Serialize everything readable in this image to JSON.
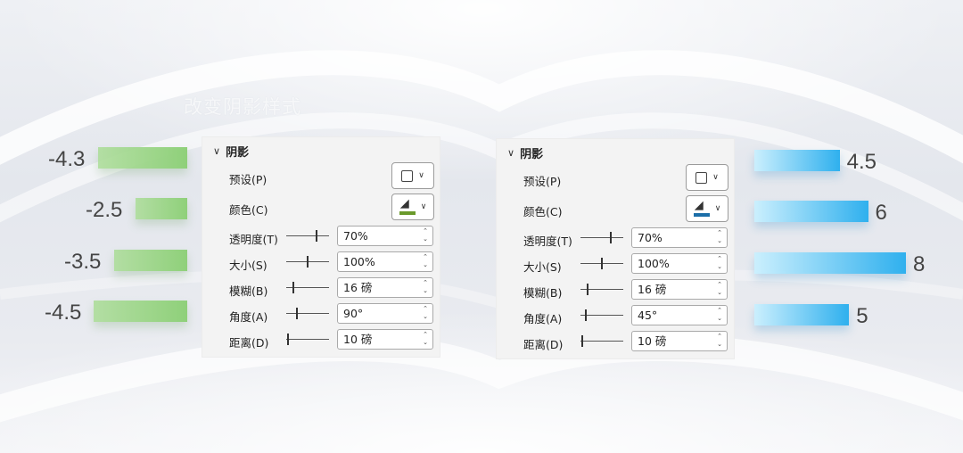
{
  "ghost_title": "改变阴影样式",
  "colors": {
    "negative_bar": "#8fd07a",
    "positive_bar": "#2fb0ee",
    "bucket_green": "#6a9a2b",
    "bucket_blue": "#1b6ea8"
  },
  "chart_data": [
    {
      "type": "bar",
      "orientation": "horizontal",
      "values": [
        -4.3,
        -2.5,
        -3.5,
        -4.5
      ],
      "labels": [
        "-4.3",
        "-2.5",
        "-3.5",
        "-4.5"
      ]
    },
    {
      "type": "bar",
      "orientation": "horizontal",
      "values": [
        4.5,
        6,
        8,
        5
      ],
      "labels": [
        "4.5",
        "6",
        "8",
        "5"
      ]
    }
  ],
  "panels": [
    {
      "header": "阴影",
      "preset_label": "预设(P)",
      "color_label": "颜色(C)",
      "bucket_color": "#6a9a2b",
      "transparency": {
        "label": "透明度(T)",
        "value": "70%",
        "level": 0.7
      },
      "size": {
        "label": "大小(S)",
        "value": "100%",
        "level": 0.5
      },
      "blur": {
        "label": "模糊(B)",
        "value": "16 磅",
        "level": 0.16
      },
      "angle": {
        "label": "角度(A)",
        "value": "90°",
        "level": 0.25
      },
      "distance": {
        "label": "距离(D)",
        "value": "10 磅",
        "level": 0.05
      }
    },
    {
      "header": "阴影",
      "preset_label": "预设(P)",
      "color_label": "颜色(C)",
      "bucket_color": "#1b6ea8",
      "transparency": {
        "label": "透明度(T)",
        "value": "70%",
        "level": 0.7
      },
      "size": {
        "label": "大小(S)",
        "value": "100%",
        "level": 0.5
      },
      "blur": {
        "label": "模糊(B)",
        "value": "16 磅",
        "level": 0.16
      },
      "angle": {
        "label": "角度(A)",
        "value": "45°",
        "level": 0.125
      },
      "distance": {
        "label": "距离(D)",
        "value": "10 磅",
        "level": 0.05
      }
    }
  ]
}
